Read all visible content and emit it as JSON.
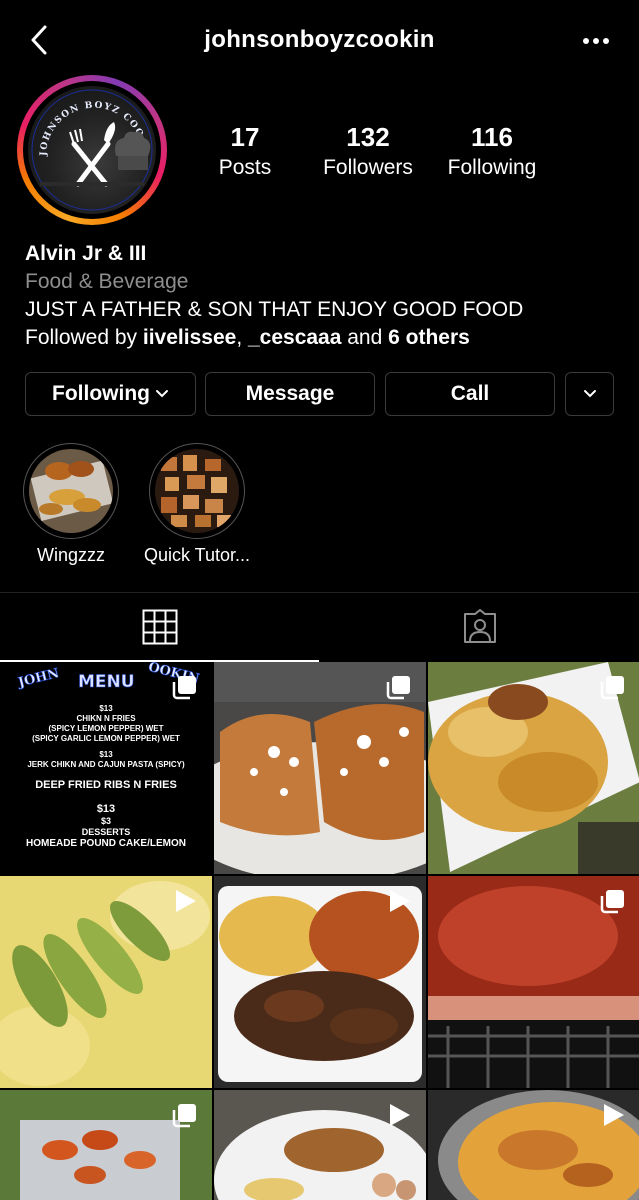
{
  "header": {
    "username": "johnsonboyzcookin",
    "back_icon": "chevron-left-icon",
    "more_icon": "more-horizontal-icon"
  },
  "avatar": {
    "logo_text": "JOHNSON BOYZ COOKING"
  },
  "stats": [
    {
      "value": "17",
      "label": "Posts"
    },
    {
      "value": "132",
      "label": "Followers"
    },
    {
      "value": "116",
      "label": "Following"
    }
  ],
  "bio": {
    "name": "Alvin Jr & III",
    "category": "Food & Beverage",
    "description": "JUST A FATHER & SON THAT ENJOY GOOD FOOD",
    "followed_by_prefix": "Followed by ",
    "followed_user_1": "iivelissee",
    "followed_sep": ", ",
    "followed_user_2": "_cescaaa",
    "followed_and": " and ",
    "followed_others": "6 others"
  },
  "actions": {
    "following": "Following",
    "message": "Message",
    "call": "Call"
  },
  "highlights": [
    {
      "label": "Wingzzz"
    },
    {
      "label": "Quick Tutor..."
    }
  ],
  "tabs": {
    "grid_icon": "grid-icon",
    "tagged_icon": "tagged-person-icon"
  },
  "menu_post": {
    "logo_text_left": "JOHN",
    "logo_text_right": "OOKIN",
    "heading": "MENU",
    "price_1": "$13",
    "item_1": "CHIKN N FRIES",
    "item_1_a": "(SPICY LEMON PEPPER) WET",
    "item_1_b": "(SPICY GARLIC LEMON PEPPER) WET",
    "price_2": "$13",
    "item_2": "JERK CHIKN AND CAJUN PASTA (SPICY)",
    "item_3": "DEEP FRIED RIBS N FRIES",
    "price_4": "$13",
    "item_4_price": "$3",
    "item_4": "DESSERTS",
    "item_5": "HOMEADE POUND CAKE/LEMON"
  },
  "colors": {
    "background": "#000000",
    "secondary_text": "#8e8e8e",
    "button_border": "#3a3a3a",
    "menu_blue": "#1f46c8"
  }
}
